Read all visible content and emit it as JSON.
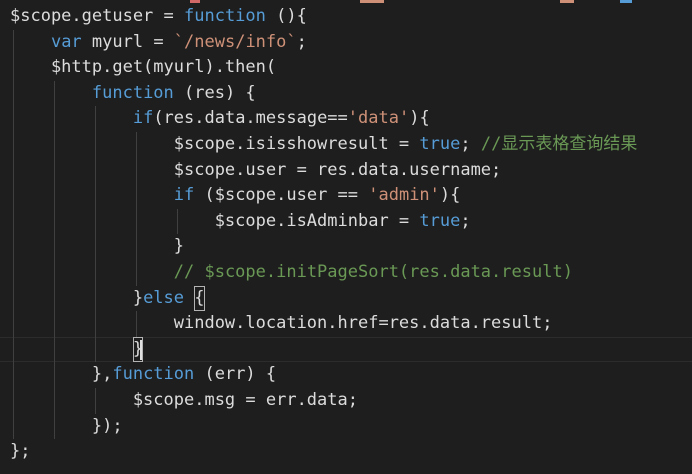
{
  "editor": {
    "theme": "dark",
    "colors": {
      "background": "#1e1e1e",
      "text": "#dcdcdc",
      "keyword": "#569cd6",
      "string": "#ce9178",
      "comment": "#6a9955",
      "indent_guide": "#404040"
    },
    "cursor_line": 14,
    "lines": [
      [
        {
          "t": "$scope.getuser = ",
          "c": "txt"
        },
        {
          "t": "function",
          "c": "kw"
        },
        {
          "t": " (){",
          "c": "txt"
        }
      ],
      [
        {
          "t": "    ",
          "c": "txt"
        },
        {
          "t": "var",
          "c": "kw"
        },
        {
          "t": " myurl = ",
          "c": "txt"
        },
        {
          "t": "`/news/info`",
          "c": "str"
        },
        {
          "t": ";",
          "c": "txt"
        }
      ],
      [
        {
          "t": "    $http.get(myurl).then(",
          "c": "txt"
        }
      ],
      [
        {
          "t": "        ",
          "c": "txt"
        },
        {
          "t": "function",
          "c": "kw"
        },
        {
          "t": " (res) {",
          "c": "txt"
        }
      ],
      [
        {
          "t": "            ",
          "c": "txt"
        },
        {
          "t": "if",
          "c": "kw"
        },
        {
          "t": "(res.data.message==",
          "c": "txt"
        },
        {
          "t": "'data'",
          "c": "str"
        },
        {
          "t": "){",
          "c": "txt"
        }
      ],
      [
        {
          "t": "                $scope.isisshowresult = ",
          "c": "txt"
        },
        {
          "t": "true",
          "c": "kw"
        },
        {
          "t": "; ",
          "c": "txt"
        },
        {
          "t": "//显示表格查询结果",
          "c": "cmt"
        }
      ],
      [
        {
          "t": "                $scope.user = res.data.username;",
          "c": "txt"
        }
      ],
      [
        {
          "t": "                ",
          "c": "txt"
        },
        {
          "t": "if",
          "c": "kw"
        },
        {
          "t": " ($scope.user == ",
          "c": "txt"
        },
        {
          "t": "'admin'",
          "c": "str"
        },
        {
          "t": "){",
          "c": "txt"
        }
      ],
      [
        {
          "t": "                    $scope.isAdminbar = ",
          "c": "txt"
        },
        {
          "t": "true",
          "c": "kw"
        },
        {
          "t": ";",
          "c": "txt"
        }
      ],
      [
        {
          "t": "                }",
          "c": "txt"
        }
      ],
      [
        {
          "t": "                ",
          "c": "txt"
        },
        {
          "t": "// $scope.initPageSort(res.data.result)",
          "c": "cmt"
        }
      ],
      [
        {
          "t": "            }",
          "c": "txt"
        },
        {
          "t": "else",
          "c": "kw"
        },
        {
          "t": " ",
          "c": "txt"
        },
        {
          "t": "{",
          "c": "txt",
          "m": true
        }
      ],
      [
        {
          "t": "                window.location.href=res.data.result;",
          "c": "txt"
        }
      ],
      [
        {
          "t": "            ",
          "c": "txt"
        },
        {
          "t": "}",
          "c": "txt",
          "m": true
        }
      ],
      [
        {
          "t": "        },",
          "c": "txt"
        },
        {
          "t": "function",
          "c": "kw"
        },
        {
          "t": " (err) {",
          "c": "txt"
        }
      ],
      [
        {
          "t": "            $scope.msg = err.data;",
          "c": "txt"
        }
      ],
      [
        {
          "t": "        });",
          "c": "txt"
        }
      ],
      [
        {
          "t": "};",
          "c": "txt"
        }
      ]
    ]
  }
}
